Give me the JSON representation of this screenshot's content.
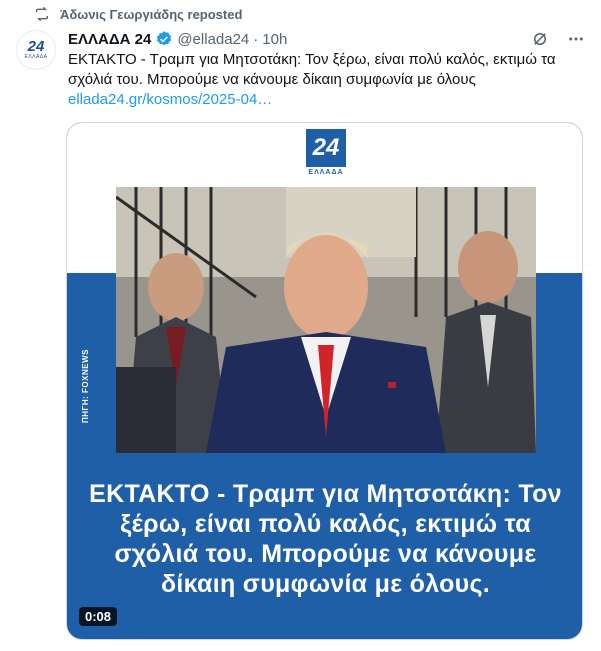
{
  "repost": {
    "label": "Άδωνις Γεωργιάδης reposted",
    "icon": "repost-icon"
  },
  "author": {
    "avatar_text": "24",
    "avatar_subtext": "ΕΛΛΑΔΑ",
    "name": "ΕΛΛΑΔΑ 24",
    "handle": "@ellada24",
    "separator": "·",
    "time": "10h",
    "verified_color": "#1d9bf0"
  },
  "tweet": {
    "text": "ΕΚΤΑΚΤΟ - Τραμπ για Μητσοτάκη: Τον ξέρω, είναι πολύ καλός, εκτιμώ τα σχόλιά του. Μπορούμε να κάνουμε δίκαιη συμφωνία με όλους",
    "link": "ellada24.gr/kosmos/2025-04…"
  },
  "media": {
    "logo_number": "24",
    "logo_word": "ΕΛΛΑΔΑ",
    "source_label": "ΠΗΓΗ: FOXNEWS",
    "caption": "ΕΚΤΑΚΤΟ - Τραμπ για Μητσοτάκη: Τον ξέρω, είναι πολύ καλός, εκτιμώ τα σχόλιά του. Μπορούμε να κάνουμε δίκαιη συμφωνία με όλους.",
    "duration": "0:08",
    "brand_color": "#1f5fa8"
  },
  "actions": {
    "grok_icon": "grok-icon",
    "more_icon": "more-icon"
  }
}
